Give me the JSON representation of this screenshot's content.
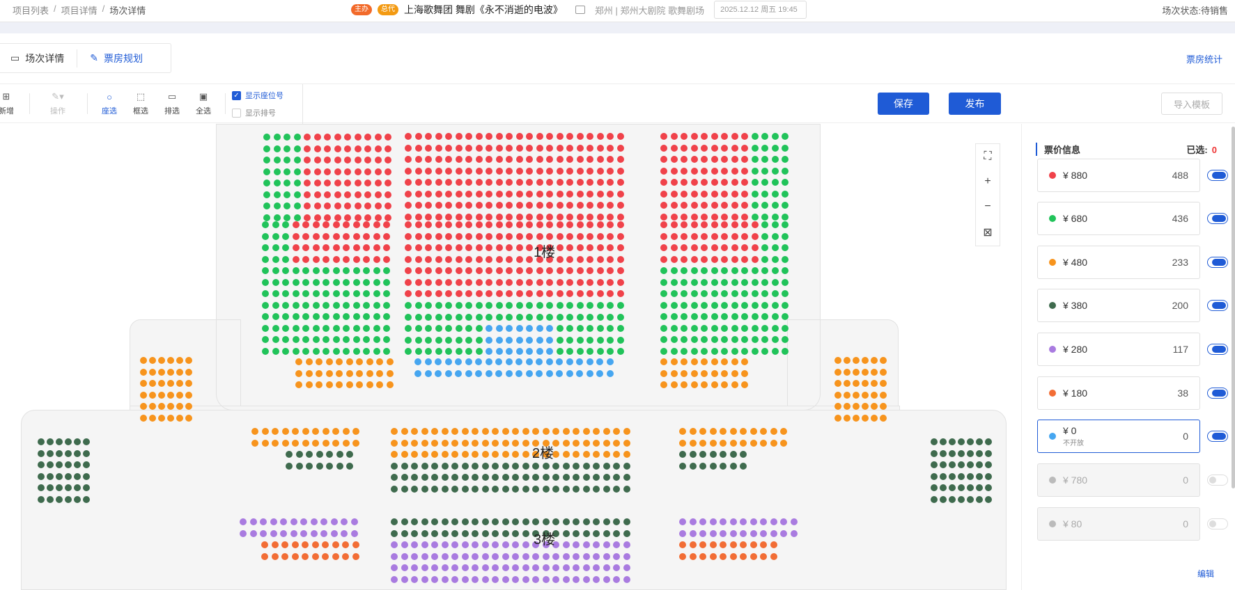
{
  "breadcrumb": {
    "items": [
      "项目列表",
      "项目详情",
      "场次详情"
    ],
    "separator": "/"
  },
  "header": {
    "tag_main": "主办",
    "tag_agent": "总代",
    "show_title": "上海歌舞团 舞剧《永不消逝的电波》",
    "venue": "郑州 | 郑州大剧院 歌舞剧场",
    "datetime": "2025.12.12 周五 19:45",
    "status": "场次状态:待销售"
  },
  "tabs": [
    {
      "label": "场次详情",
      "icon": "ticket-icon",
      "active": false
    },
    {
      "label": "票房规划",
      "icon": "edit-icon",
      "active": true
    }
  ],
  "box_office_stats_link": "票房统计",
  "toolbar": {
    "tools": [
      {
        "label": "新增",
        "icon": "add-icon",
        "state": "normal"
      },
      {
        "label": "操作",
        "icon": "edit-dropdown-icon",
        "state": "disabled"
      },
      {
        "label": "座选",
        "icon": "circle-icon",
        "state": "active"
      },
      {
        "label": "框选",
        "icon": "box-select-icon",
        "state": "normal"
      },
      {
        "label": "排选",
        "icon": "row-select-icon",
        "state": "normal"
      },
      {
        "label": "全选",
        "icon": "select-all-icon",
        "state": "normal"
      }
    ],
    "show_seat_number": {
      "label": "显示座位号",
      "checked": true
    },
    "show_row_number": {
      "label": "显示排号",
      "checked": false
    },
    "save_label": "保存",
    "publish_label": "发布",
    "import_template_label": "导入模板"
  },
  "seat_map": {
    "floor_labels": [
      "1楼",
      "2楼",
      "3楼"
    ],
    "zoom_controls": [
      "fullscreen-icon",
      "zoom-in-icon",
      "zoom-out-icon",
      "fit-icon"
    ]
  },
  "price_panel": {
    "title": "票价信息",
    "selected_label": "已选:",
    "selected_count": "0",
    "prices": [
      {
        "label": "¥ 880",
        "count": "488",
        "color": "#f0424a",
        "enabled": true
      },
      {
        "label": "¥ 680",
        "count": "436",
        "color": "#21c35a",
        "enabled": true
      },
      {
        "label": "¥ 480",
        "count": "233",
        "color": "#f7941d",
        "enabled": true
      },
      {
        "label": "¥ 380",
        "count": "200",
        "color": "#3f6b4e",
        "enabled": true
      },
      {
        "label": "¥ 280",
        "count": "117",
        "color": "#a97be0",
        "enabled": true
      },
      {
        "label": "¥ 180",
        "count": "38",
        "color": "#f26d35",
        "enabled": true
      },
      {
        "label": "¥ 0",
        "sub": "不开放",
        "count": "0",
        "color": "#46a6f0",
        "enabled": true,
        "selected": true
      },
      {
        "label": "¥ 780",
        "count": "0",
        "color": "#bbbbbb",
        "enabled": false
      },
      {
        "label": "¥ 80",
        "count": "0",
        "color": "#bbbbbb",
        "enabled": false
      }
    ],
    "edit_label": "编辑"
  },
  "colors": {
    "accent": "#1f5bd6",
    "red": "#f0424a",
    "green": "#21c35a",
    "orange": "#f7941d",
    "dark_green": "#3f6b4e",
    "purple": "#a97be0",
    "blue": "#46a6f0",
    "coral": "#f26d35"
  }
}
